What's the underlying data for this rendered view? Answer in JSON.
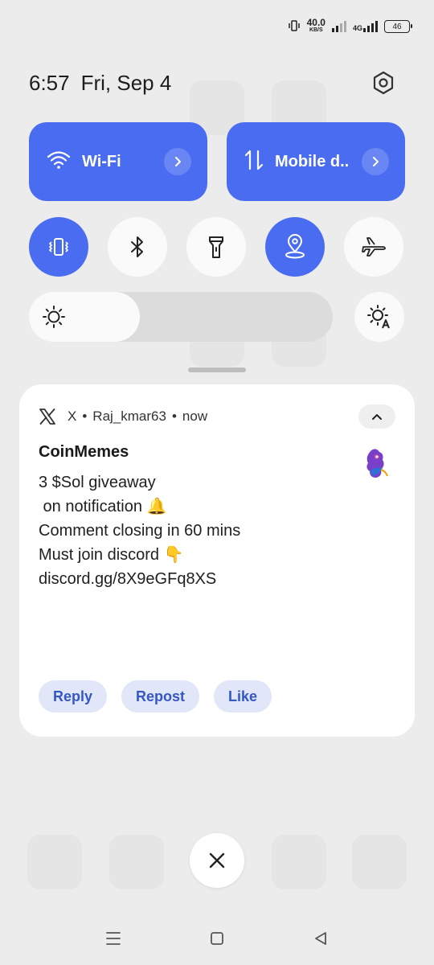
{
  "status_bar": {
    "speed_value": "40.0",
    "speed_unit": "KB/S",
    "network": "4G",
    "battery": "46"
  },
  "header": {
    "time": "6:57",
    "date": "Fri, Sep 4"
  },
  "tiles": [
    {
      "label": "Wi-Fi"
    },
    {
      "label": "Mobile d.."
    }
  ],
  "toggles": [
    {
      "icon": "vibrate-icon",
      "state": "on"
    },
    {
      "icon": "bluetooth-icon",
      "state": "off"
    },
    {
      "icon": "flashlight-icon",
      "state": "off"
    },
    {
      "icon": "location-icon",
      "state": "on"
    },
    {
      "icon": "airplane-icon",
      "state": "off"
    }
  ],
  "brightness": {
    "level": 0.28
  },
  "notification": {
    "app": "X",
    "account": "Raj_kmar63",
    "time": "now",
    "title": "CoinMemes",
    "lines": [
      "3 $Sol giveaway",
      "",
      " on notification 🔔",
      "",
      "Comment closing in 60 mins",
      "",
      "Must join discord 👇",
      "discord.gg/8X9eGFq8XS"
    ],
    "actions": [
      "Reply",
      "Repost",
      "Like"
    ]
  },
  "colors": {
    "accent": "#4a6cf0",
    "action_bg": "#e1e6f8",
    "action_text": "#3557c5"
  }
}
